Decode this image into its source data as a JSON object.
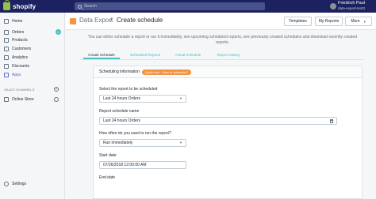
{
  "topbar": {
    "brand": "shopify",
    "search_placeholder": "Search",
    "user_name": "Friedrich Paul",
    "user_store": "data-export-test3"
  },
  "sidebar": {
    "items": [
      {
        "label": "Home",
        "icon": "home-icon"
      },
      {
        "label": "Orders",
        "icon": "orders-icon",
        "badge": "2"
      },
      {
        "label": "Products",
        "icon": "products-icon"
      },
      {
        "label": "Customers",
        "icon": "customers-icon"
      },
      {
        "label": "Analytics",
        "icon": "analytics-icon"
      },
      {
        "label": "Discounts",
        "icon": "discounts-icon"
      },
      {
        "label": "Apps",
        "icon": "apps-icon"
      }
    ],
    "sales_channels_heading": "SALES CHANNELS",
    "online_store": "Online Store",
    "settings": "Settings",
    "accent_color": "#5c6ac4"
  },
  "header": {
    "breadcrumb": "Data Export",
    "separator": "/",
    "title": "Create schedule",
    "templates_button": "Templates",
    "my_reports_button": "My Reports",
    "more_button": "More"
  },
  "description": "You can either schedule a report or run it immediately, see upcoming scheduled reports, see previously created schedules and download recently created reports.",
  "tabs": [
    "Create Schedule",
    "Scheduled Reports",
    "Actual Schedule",
    "Report History"
  ],
  "card": {
    "section_title": "Scheduling information",
    "help_pill": "Quick tour - How to schedule?",
    "report_label": "Select the report to be scheduled",
    "report_value": "Last 24 hours Orders",
    "name_label": "Report schedule name",
    "name_value": "Last 24 hours Orders",
    "frequency_label": "How often do you want to run the report?",
    "frequency_value": "Run immediately",
    "start_label": "Start date",
    "start_value": "07/26/2018 12:00:00 AM",
    "end_label": "End date"
  },
  "colors": {
    "topbar": "#1c2260",
    "accent_teal": "#47c1bf",
    "pill_orange": "#f49342"
  }
}
